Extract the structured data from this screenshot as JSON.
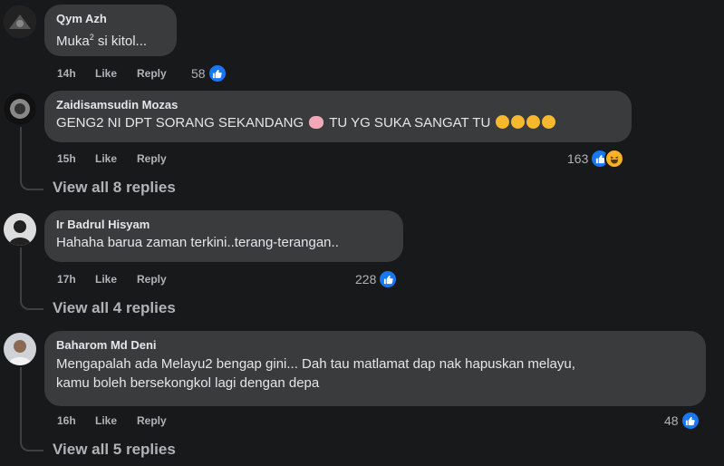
{
  "comments": [
    {
      "author": "Qym Azh",
      "text": "Muka",
      "text_sup": "2",
      "text_rest": " si kitol...",
      "time": "14h",
      "like_label": "Like",
      "reply_label": "Reply",
      "reaction_count": "58"
    },
    {
      "author": "Zaidisamsudin Mozas",
      "text_a": "GENG2 NI DPT SORANG SEKANDANG",
      "text_b": "TU YG SUKA SANGAT TU",
      "time": "15h",
      "like_label": "Like",
      "reply_label": "Reply",
      "reaction_count": "163",
      "view_replies": "View all 8 replies"
    },
    {
      "author": "Ir Badrul Hisyam",
      "text": "Hahaha barua zaman terkini..terang-terangan..",
      "time": "17h",
      "like_label": "Like",
      "reply_label": "Reply",
      "reaction_count": "228",
      "view_replies": "View all 4 replies"
    },
    {
      "author": "Baharom Md Deni",
      "text_line1": "Mengapalah ada Melayu2 bengap gini... Dah tau matlamat dap nak hapuskan melayu,",
      "text_line2": "kamu boleh bersekongkol lagi dengan depa",
      "time": "16h",
      "like_label": "Like",
      "reply_label": "Reply",
      "reaction_count": "48",
      "view_replies": "View all 5 replies"
    }
  ],
  "colors": {
    "background": "#18191a",
    "bubble": "#3a3b3c",
    "text": "#e4e6eb",
    "secondary": "#b0b3b8",
    "like_blue": "#1877f2"
  },
  "icons": [
    "like-icon",
    "haha-icon",
    "laughing-emoji-icon",
    "pig-emoji-icon"
  ]
}
